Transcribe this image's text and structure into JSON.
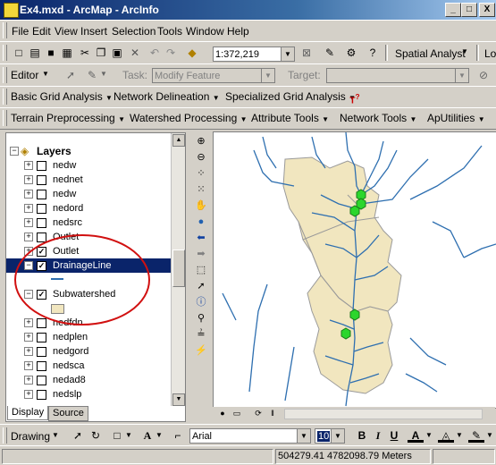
{
  "window": {
    "title": "Ex4.mxd - ArcMap - ArcInfo",
    "minimize": "_",
    "maximize": "□",
    "close": "X"
  },
  "menu": [
    "File",
    "Edit",
    "View",
    "Insert",
    "Selection",
    "Tools",
    "Window",
    "Help"
  ],
  "standard_toolbar": {
    "scale": "1:372,219",
    "spatial_analyst": "Spatial Analyst",
    "cut_off": "Lo"
  },
  "editor_toolbar": {
    "editor": "Editor",
    "task_label": "Task:",
    "task_value": "Modify Feature",
    "target_label": "Target:"
  },
  "hydro_toolbar": [
    "Basic Grid Analysis",
    "Network Delineation",
    "Specialized Grid Analysis"
  ],
  "hydro_toolbar2": [
    "Terrain Preprocessing",
    "Watershed Processing",
    "Attribute Tools",
    "Network Tools",
    "ApUtilities"
  ],
  "toc": {
    "root": "Layers",
    "layers": [
      {
        "name": "nedw",
        "checked": false
      },
      {
        "name": "nednet",
        "checked": false
      },
      {
        "name": "nedw",
        "checked": false
      },
      {
        "name": "nedord",
        "checked": false
      },
      {
        "name": "nedsrc",
        "checked": false
      },
      {
        "name": "Outlet",
        "checked": false
      },
      {
        "name": "Outlet",
        "checked": true
      },
      {
        "name": "DrainageLine",
        "checked": true,
        "selected": true
      },
      {
        "name": "Subwatershed",
        "checked": true
      },
      {
        "name": "nedfdn",
        "checked": false
      },
      {
        "name": "nedplen",
        "checked": false
      },
      {
        "name": "nedgord",
        "checked": false
      },
      {
        "name": "nedsca",
        "checked": false
      },
      {
        "name": "nedad8",
        "checked": false
      },
      {
        "name": "nedslp",
        "checked": false
      }
    ],
    "tabs": [
      "Display",
      "Source"
    ]
  },
  "draw_toolbar": {
    "drawing": "Drawing",
    "font": "Arial",
    "size": "10",
    "bold": "B",
    "italic": "I",
    "underline": "U"
  },
  "status": {
    "coords": "504279.41  4782098.79 Meters"
  },
  "colors": {
    "title_start": "#0a246a",
    "selection": "#0a246a",
    "watershed_fill": "#f1e6bf",
    "stream": "#2e6fb0",
    "outlet": "#2cd62c",
    "annotation": "#d11010"
  }
}
